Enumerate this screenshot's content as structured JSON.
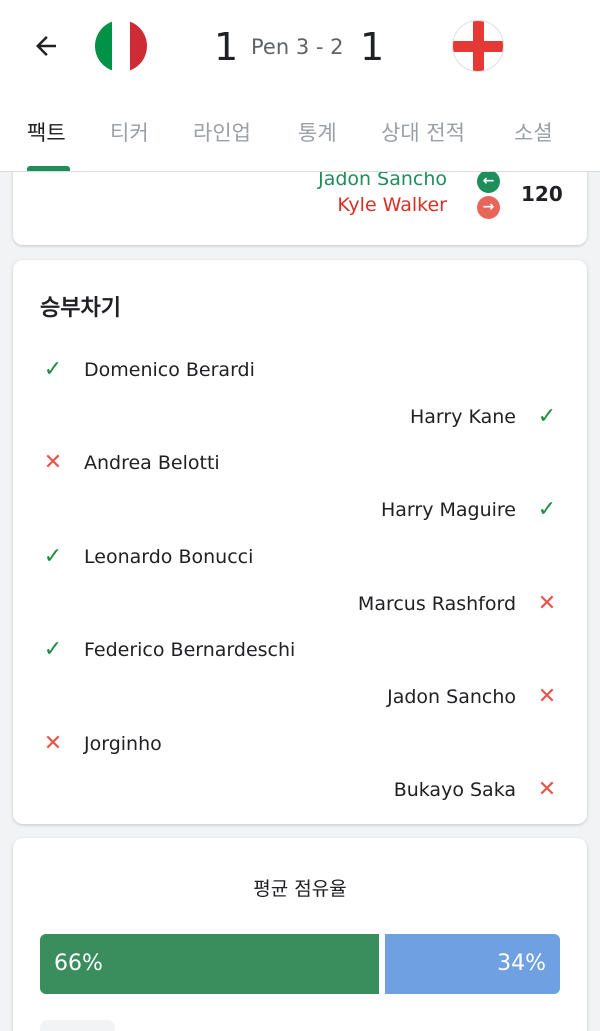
{
  "header": {
    "back_icon": "arrow-left-icon",
    "home_flag": "italy-flag-icon",
    "away_flag": "england-flag-icon",
    "home_score": "1",
    "penalty_text": "Pen 3 - 2",
    "away_score": "1"
  },
  "tabs": [
    "팩트",
    "티커",
    "라인업",
    "통계",
    "상대 전적",
    "소셜"
  ],
  "substitution": {
    "player_in": "Jadon Sancho",
    "player_out": "Kyle Walker",
    "minute": "120",
    "in_color": "#1e8e5a",
    "out_color": "#d93025"
  },
  "penalties": {
    "title": "승부차기",
    "kicks": [
      {
        "side": "home",
        "player": "Domenico Berardi",
        "result": "scored"
      },
      {
        "side": "away",
        "player": "Harry Kane",
        "result": "scored"
      },
      {
        "side": "home",
        "player": "Andrea Belotti",
        "result": "missed"
      },
      {
        "side": "away",
        "player": "Harry Maguire",
        "result": "scored"
      },
      {
        "side": "home",
        "player": "Leonardo Bonucci",
        "result": "scored"
      },
      {
        "side": "away",
        "player": "Marcus Rashford",
        "result": "missed"
      },
      {
        "side": "home",
        "player": "Federico Bernardeschi",
        "result": "scored"
      },
      {
        "side": "away",
        "player": "Jadon Sancho",
        "result": "missed"
      },
      {
        "side": "home",
        "player": "Jorginho",
        "result": "missed"
      },
      {
        "side": "away",
        "player": "Bukayo Saka",
        "result": "missed"
      }
    ]
  },
  "possession": {
    "title": "평균 점유율",
    "home_label": "66%",
    "away_label": "34%",
    "home_value": 66,
    "away_value": 34,
    "home_color": "#3a8d5d",
    "away_color": "#6fa0e2"
  }
}
